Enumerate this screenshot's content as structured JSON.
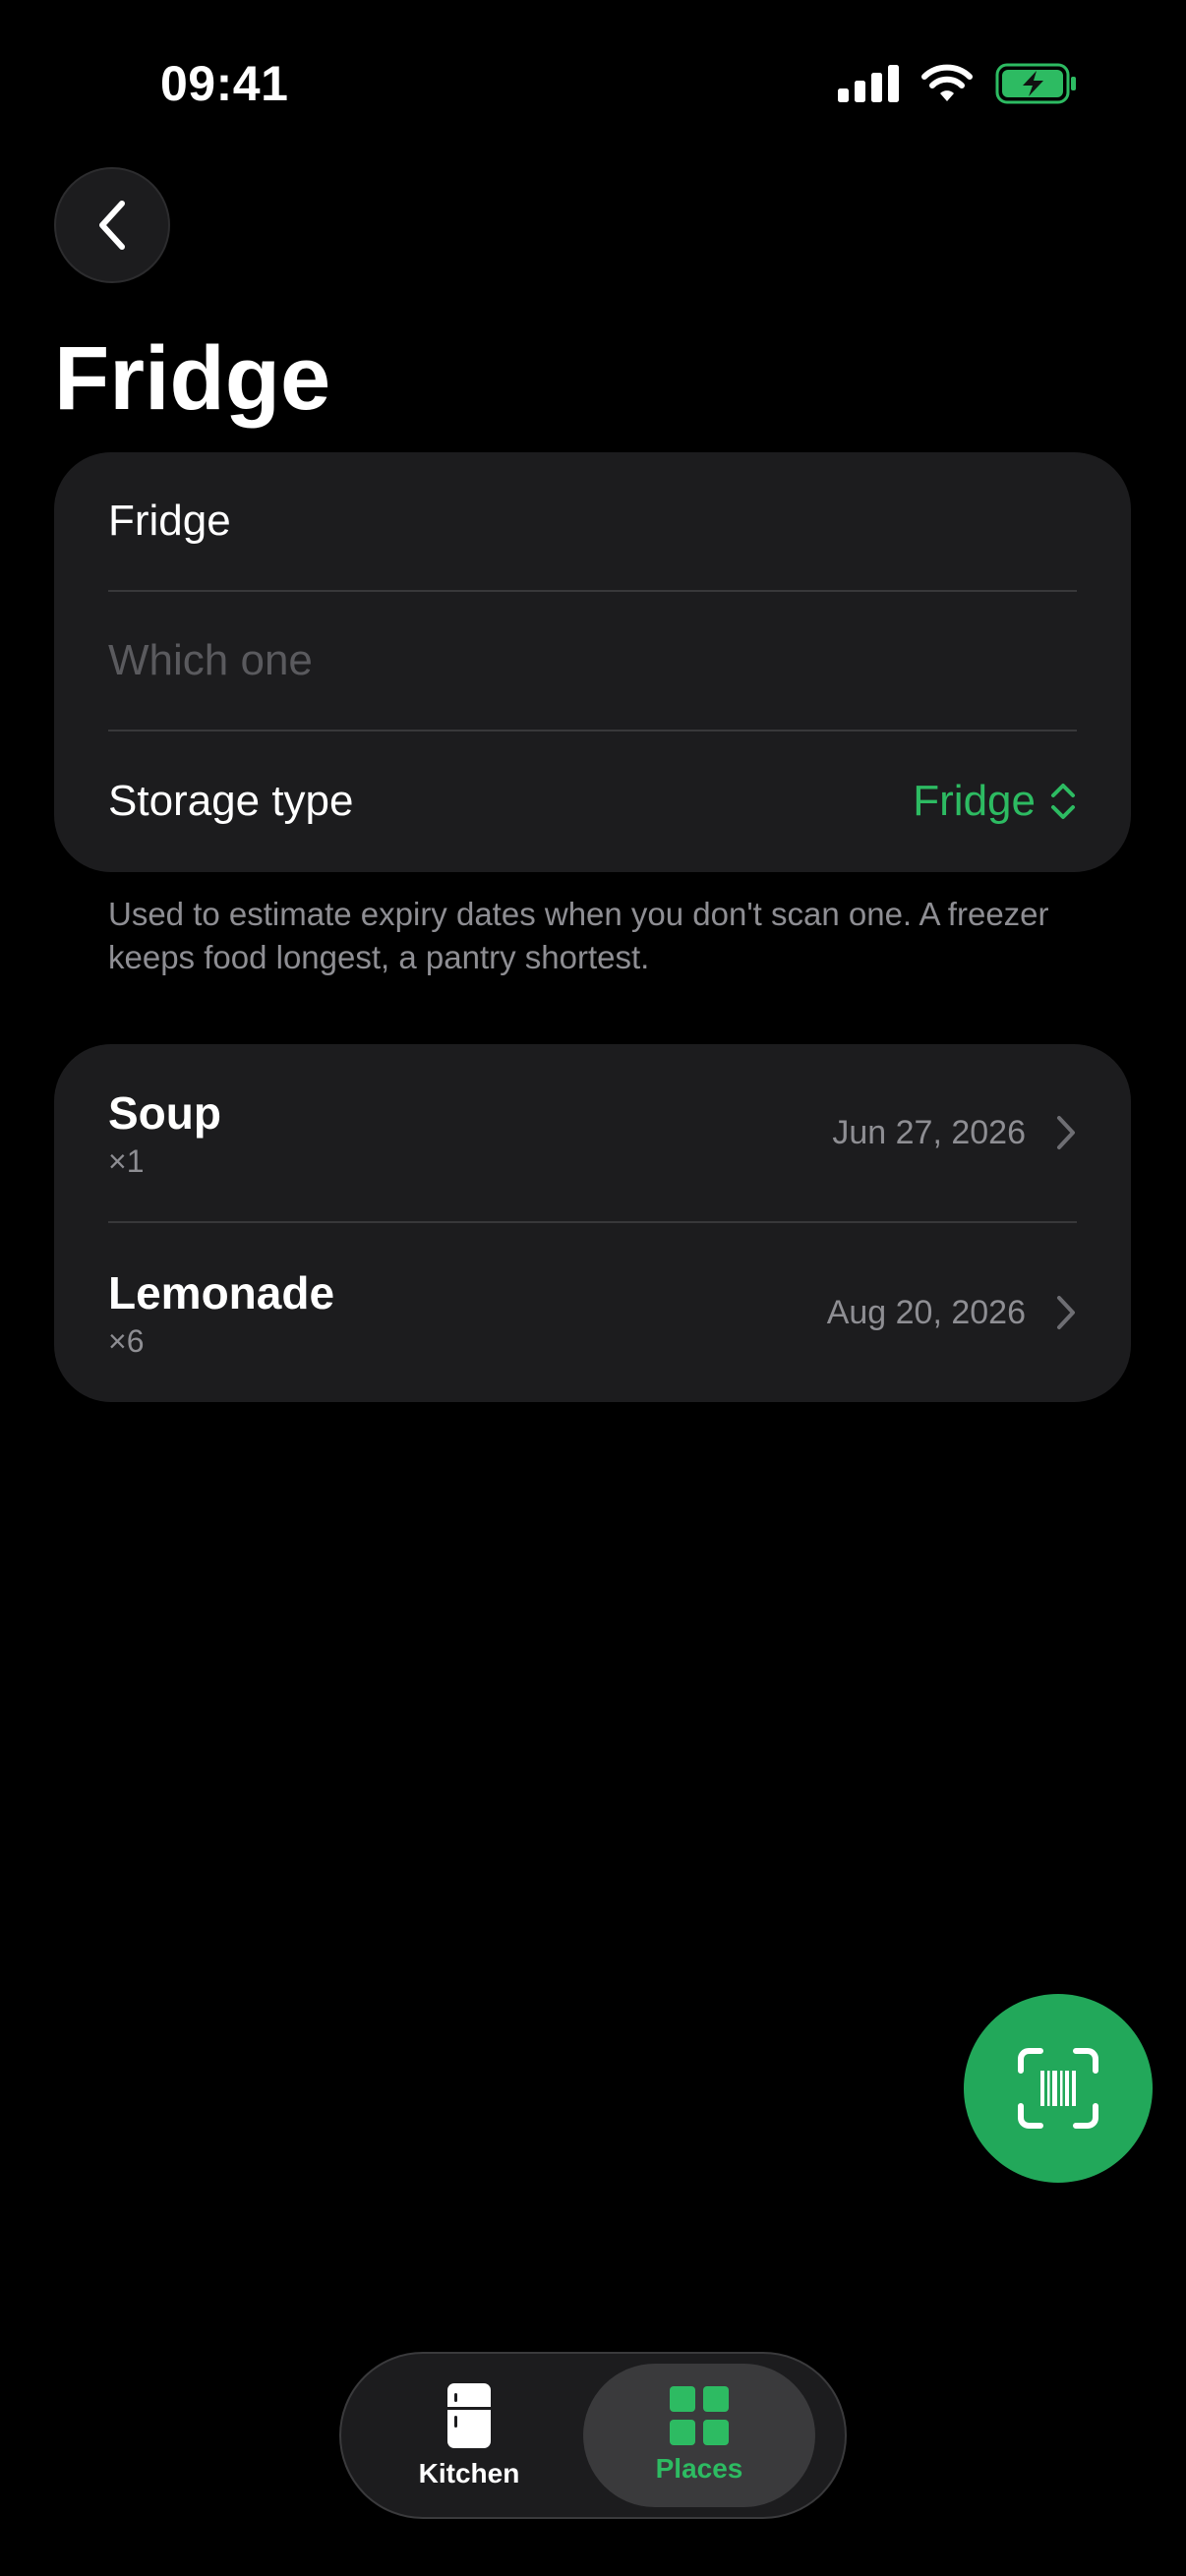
{
  "status_bar": {
    "time": "09:41"
  },
  "header": {
    "title": "Fridge"
  },
  "form": {
    "name_value": "Fridge",
    "which_placeholder": "Which one",
    "storage_label": "Storage type",
    "storage_value": "Fridge",
    "footnote": "Used to estimate expiry dates when you don't scan one. A freezer keeps food longest, a pantry shortest."
  },
  "items": [
    {
      "name": "Soup",
      "quantity": "×1",
      "date": "Jun 27, 2026"
    },
    {
      "name": "Lemonade",
      "quantity": "×6",
      "date": "Aug 20, 2026"
    }
  ],
  "tab_bar": {
    "tabs": [
      {
        "label": "Kitchen",
        "icon": "fridge-icon",
        "selected": false
      },
      {
        "label": "Places",
        "icon": "grid-icon",
        "selected": true
      }
    ]
  },
  "colors": {
    "accent": "#2dbb62",
    "fab": "#22a85a",
    "card": "#1c1c1e",
    "background": "#000000"
  },
  "icons": {
    "back": "chevron-left-icon",
    "scan": "barcode-scan-icon",
    "storage_picker": "chevron-up-down-icon",
    "row_disclosure": "chevron-right-icon"
  }
}
